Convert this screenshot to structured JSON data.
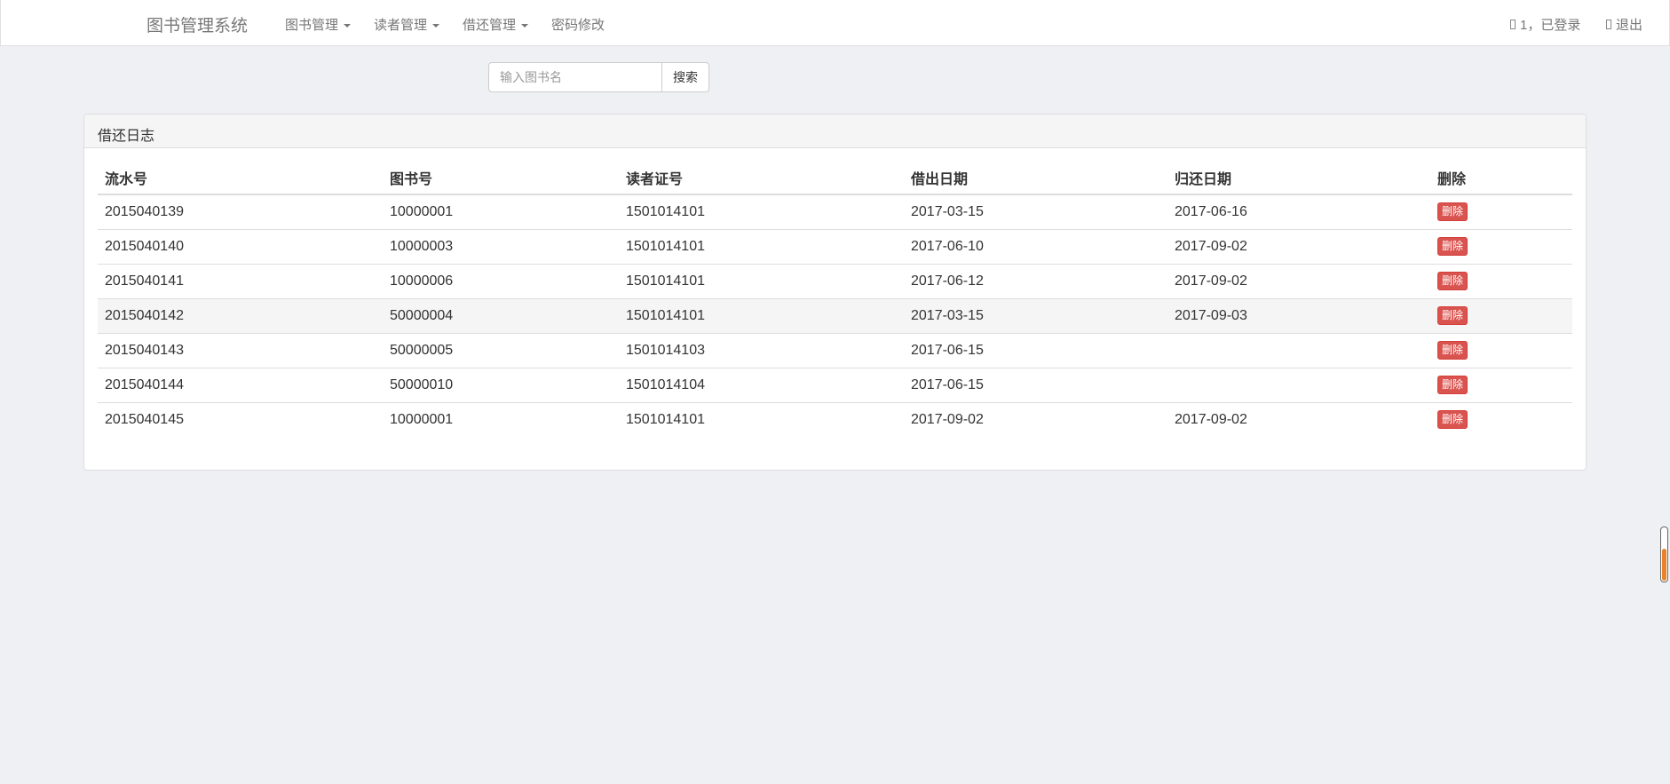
{
  "navbar": {
    "brand": "图书管理系统",
    "items": [
      {
        "label": "图书管理",
        "dropdown": true
      },
      {
        "label": "读者管理",
        "dropdown": true
      },
      {
        "label": "借还管理",
        "dropdown": true
      },
      {
        "label": "密码修改",
        "dropdown": false
      }
    ],
    "user_status": "1，已登录",
    "logout": "退出"
  },
  "search": {
    "placeholder": "输入图书名",
    "button": "搜索"
  },
  "panel": {
    "title": "借还日志",
    "columns": [
      "流水号",
      "图书号",
      "读者证号",
      "借出日期",
      "归还日期",
      "删除"
    ],
    "rows": [
      {
        "serial": "2015040139",
        "book_id": "10000001",
        "reader_id": "1501014101",
        "lend_date": "2017-03-15",
        "return_date": "2017-06-16",
        "action": "删除"
      },
      {
        "serial": "2015040140",
        "book_id": "10000003",
        "reader_id": "1501014101",
        "lend_date": "2017-06-10",
        "return_date": "2017-09-02",
        "action": "删除"
      },
      {
        "serial": "2015040141",
        "book_id": "10000006",
        "reader_id": "1501014101",
        "lend_date": "2017-06-12",
        "return_date": "2017-09-02",
        "action": "删除"
      },
      {
        "serial": "2015040142",
        "book_id": "50000004",
        "reader_id": "1501014101",
        "lend_date": "2017-03-15",
        "return_date": "2017-09-03",
        "action": "删除"
      },
      {
        "serial": "2015040143",
        "book_id": "50000005",
        "reader_id": "1501014103",
        "lend_date": "2017-06-15",
        "return_date": "",
        "action": "删除"
      },
      {
        "serial": "2015040144",
        "book_id": "50000010",
        "reader_id": "1501014104",
        "lend_date": "2017-06-15",
        "return_date": "",
        "action": "删除"
      },
      {
        "serial": "2015040145",
        "book_id": "10000001",
        "reader_id": "1501014101",
        "lend_date": "2017-09-02",
        "return_date": "2017-09-02",
        "action": "删除"
      }
    ]
  },
  "colors": {
    "delete_button": "#d9534f",
    "background": "#eff0f4",
    "scroll_indicator": "#e8832b"
  },
  "icons": {
    "user": "user-icon",
    "logout": "logout-icon"
  }
}
